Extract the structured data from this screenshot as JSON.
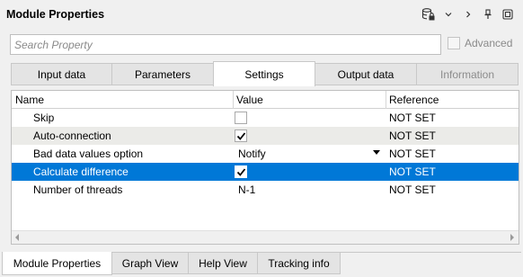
{
  "window": {
    "title": "Module Properties",
    "icons": [
      "database-lock-icon",
      "chevron-down-icon",
      "chevron-right-icon",
      "pin-icon",
      "maximize-icon"
    ],
    "icon_glyphs": [
      "",
      "⌄",
      "›",
      "📌",
      "⧉"
    ]
  },
  "search": {
    "placeholder": "Search Property",
    "value": ""
  },
  "advanced": {
    "label": "Advanced",
    "checked": false
  },
  "tabs": [
    {
      "label": "Input data",
      "state": "normal"
    },
    {
      "label": "Parameters",
      "state": "normal"
    },
    {
      "label": "Settings",
      "state": "active"
    },
    {
      "label": "Output data",
      "state": "normal"
    },
    {
      "label": "Information",
      "state": "disabled"
    }
  ],
  "grid": {
    "headers": {
      "name": "Name",
      "value": "Value",
      "reference": "Reference"
    },
    "rows": [
      {
        "name": "Skip",
        "value_type": "checkbox",
        "checked": false,
        "reference": "NOT SET"
      },
      {
        "name": "Auto-connection",
        "value_type": "checkbox",
        "checked": true,
        "reference": "NOT SET"
      },
      {
        "name": "Bad data values option",
        "value_type": "dropdown",
        "value": "Notify",
        "reference": "NOT SET"
      },
      {
        "name": "Calculate difference",
        "value_type": "checkbox",
        "checked": true,
        "reference": "NOT SET",
        "selected": true
      },
      {
        "name": "Number of threads",
        "value_type": "text",
        "value": "N-1",
        "reference": "NOT SET"
      }
    ]
  },
  "bottom_tabs": [
    {
      "label": "Module Properties",
      "active": true
    },
    {
      "label": "Graph View",
      "active": false
    },
    {
      "label": "Help View",
      "active": false
    },
    {
      "label": "Tracking info",
      "active": false
    }
  ],
  "colors": {
    "selection": "#0078d7",
    "alt_row": "#ebebe8",
    "disabled_text": "#8c8c8c"
  }
}
